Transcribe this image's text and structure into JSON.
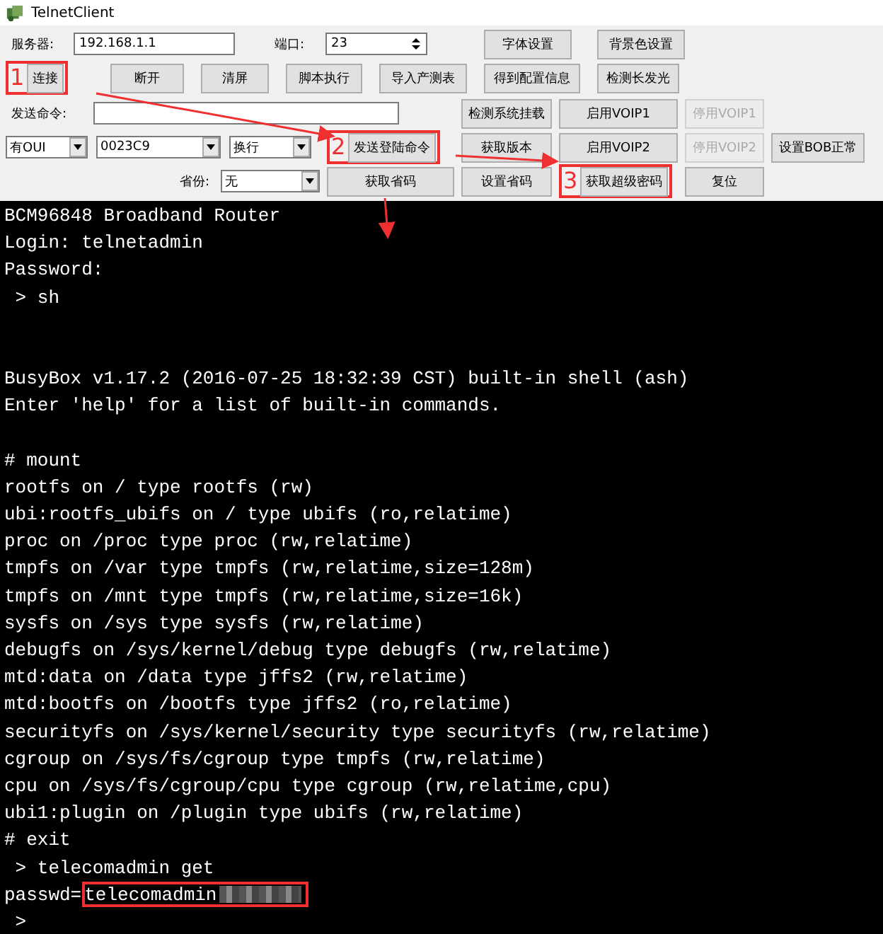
{
  "window": {
    "title": "TelnetClient"
  },
  "server": {
    "label": "服务器:",
    "value": "192.168.1.1"
  },
  "port": {
    "label": "端口:",
    "value": "23"
  },
  "top_buttons": [
    {
      "label": "字体设置"
    },
    {
      "label": "背景色设置"
    }
  ],
  "action_buttons": [
    {
      "label": "连接",
      "mark": "1"
    },
    {
      "label": "断开"
    },
    {
      "label": "清屏"
    },
    {
      "label": "脚本执行"
    },
    {
      "label": "导入产测表"
    },
    {
      "label": "得到配置信息"
    },
    {
      "label": "检测长发光"
    }
  ],
  "send_command": {
    "label": "发送命令:"
  },
  "dropdowns": [
    {
      "value": "有OUI"
    },
    {
      "value": "0023C9"
    },
    {
      "value": "换行"
    }
  ],
  "province": {
    "label": "省份:",
    "value": "无"
  },
  "grid_buttons": [
    {
      "label": "检测系统挂载",
      "disabled": false
    },
    {
      "label": "启用VOIP1",
      "disabled": false
    },
    {
      "label": "停用VOIP1",
      "disabled": true
    },
    {
      "label": "发送登陆命令",
      "disabled": false,
      "mark": "2"
    },
    {
      "label": "获取版本",
      "disabled": false
    },
    {
      "label": "启用VOIP2",
      "disabled": false
    },
    {
      "label": "停用VOIP2",
      "disabled": true
    },
    {
      "label": "设置BOB正常",
      "disabled": false
    },
    {
      "label": "获取省码",
      "disabled": false
    },
    {
      "label": "设置省码",
      "disabled": false
    },
    {
      "label": "获取超级密码",
      "disabled": false,
      "mark": "3"
    },
    {
      "label": "复位",
      "disabled": false
    }
  ],
  "terminal": [
    {
      "kind": "text",
      "text": "BCM96848 Broadband Router"
    },
    {
      "kind": "text",
      "text": "Login: telnetadmin"
    },
    {
      "kind": "text",
      "text": "Password:"
    },
    {
      "kind": "text",
      "text": " > sh"
    },
    {
      "kind": "blank"
    },
    {
      "kind": "blank"
    },
    {
      "kind": "text",
      "text": "BusyBox v1.17.2 (2016-07-25 18:32:39 CST) built-in shell (ash)"
    },
    {
      "kind": "text",
      "text": "Enter 'help' for a list of built-in commands."
    },
    {
      "kind": "blank"
    },
    {
      "kind": "text",
      "text": "# mount"
    },
    {
      "kind": "text",
      "text": "rootfs on / type rootfs (rw)"
    },
    {
      "kind": "text",
      "text": "ubi:rootfs_ubifs on / type ubifs (ro,relatime)"
    },
    {
      "kind": "text",
      "text": "proc on /proc type proc (rw,relatime)"
    },
    {
      "kind": "text",
      "text": "tmpfs on /var type tmpfs (rw,relatime,size=128m)"
    },
    {
      "kind": "text",
      "text": "tmpfs on /mnt type tmpfs (rw,relatime,size=16k)"
    },
    {
      "kind": "text",
      "text": "sysfs on /sys type sysfs (rw,relatime)"
    },
    {
      "kind": "text",
      "text": "debugfs on /sys/kernel/debug type debugfs (rw,relatime)"
    },
    {
      "kind": "text",
      "text": "mtd:data on /data type jffs2 (rw,relatime)"
    },
    {
      "kind": "text",
      "text": "mtd:bootfs on /bootfs type jffs2 (ro,relatime)"
    },
    {
      "kind": "text",
      "text": "securityfs on /sys/kernel/security type securityfs (rw,relatime)"
    },
    {
      "kind": "text",
      "text": "cgroup on /sys/fs/cgroup type tmpfs (rw,relatime)"
    },
    {
      "kind": "text",
      "text": "cpu on /sys/fs/cgroup/cpu type cgroup (rw,relatime,cpu)"
    },
    {
      "kind": "text",
      "text": "ubi1:plugin on /plugin type ubifs (rw,relatime)"
    },
    {
      "kind": "text",
      "text": "# exit"
    },
    {
      "kind": "text",
      "text": " > telecomadmin get"
    },
    {
      "kind": "password",
      "prefix": "passwd=",
      "text": "telecomadmin",
      "redacted": true
    },
    {
      "kind": "text",
      "text": " >"
    }
  ]
}
